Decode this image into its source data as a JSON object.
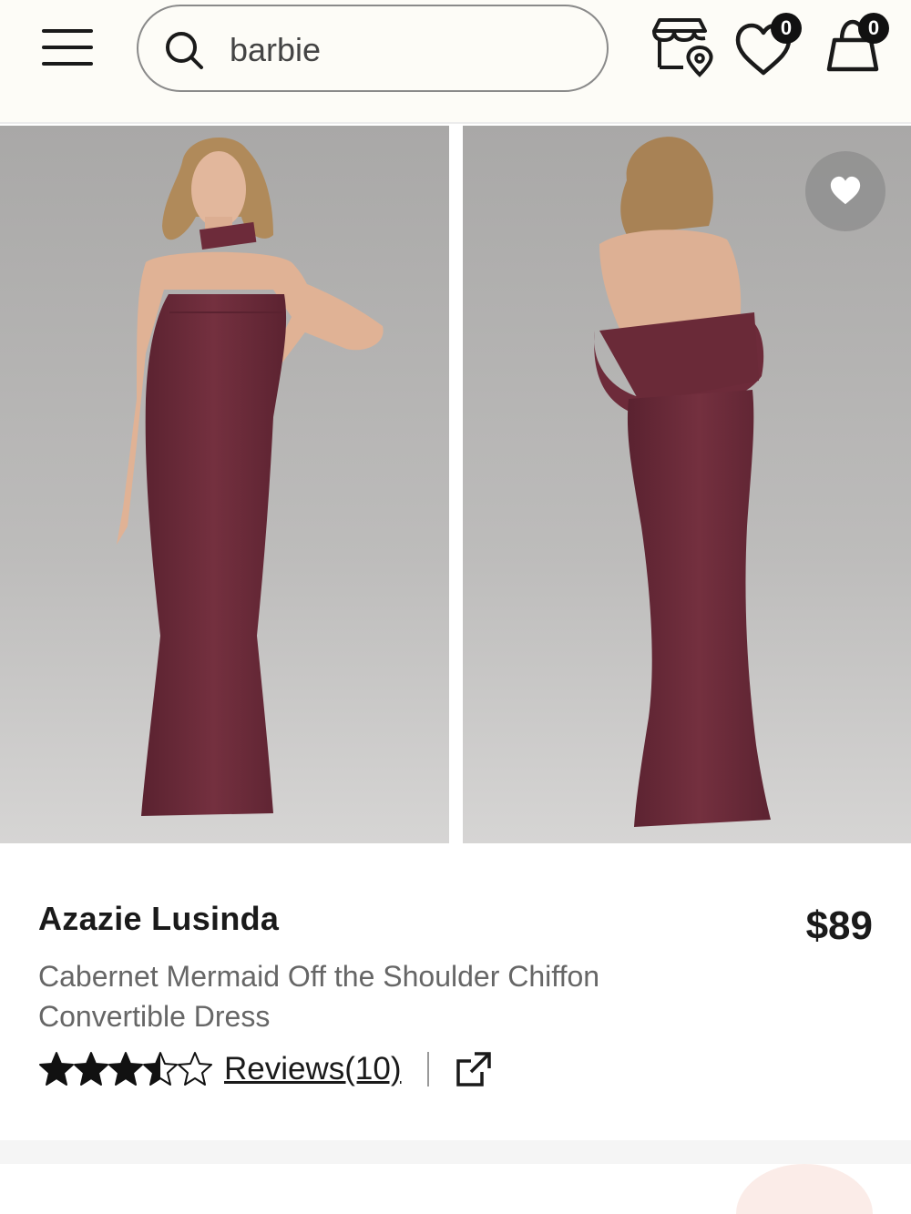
{
  "header": {
    "search": {
      "value": "barbie",
      "placeholder": "Search"
    },
    "wishlist_count": "0",
    "bag_count": "0",
    "icons": [
      "menu-icon",
      "search-icon",
      "store-locator-icon",
      "heart-icon",
      "shopping-bag-icon"
    ]
  },
  "gallery": {
    "images": [
      {
        "name": "front view"
      },
      {
        "name": "back view"
      }
    ],
    "fav_icon": "heart-icon"
  },
  "product": {
    "brand": "Azazie Lusinda",
    "price": "$89",
    "description": "Cabernet Mermaid Off the Shoulder Chiffon Convertible Dress",
    "rating": 3.5,
    "max_rating": 5,
    "reviews_label": "Reviews(10)",
    "share_icon": "external-link-icon"
  },
  "colors": {
    "dress": "#6d2b3a",
    "backdrop": "#b4b3b2",
    "text_primary": "#1a1a1a",
    "text_secondary": "#666666",
    "header_bg": "#fdfcf7"
  }
}
